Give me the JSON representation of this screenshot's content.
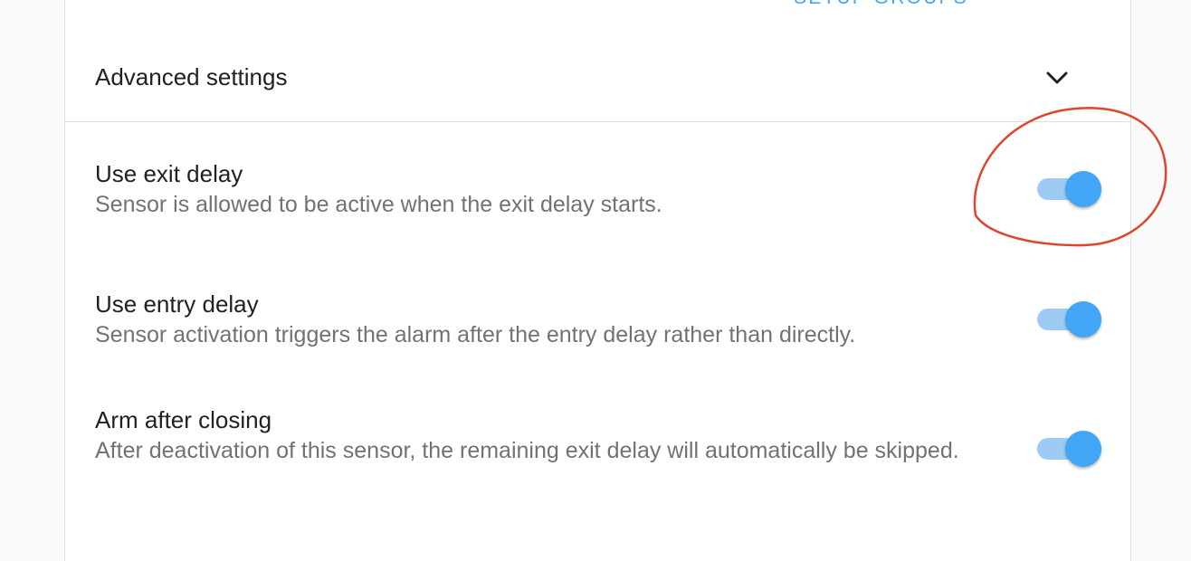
{
  "header": {
    "setup_groups_label": "SETUP GROUPS"
  },
  "advanced": {
    "title": "Advanced settings",
    "expanded": true,
    "chevron_icon": "chevron-down-icon"
  },
  "settings": [
    {
      "title": "Use exit delay",
      "description": "Sensor is allowed to be active when the exit delay starts.",
      "enabled": true
    },
    {
      "title": "Use entry delay",
      "description": "Sensor activation triggers the alarm after the entry delay rather than directly.",
      "enabled": true
    },
    {
      "title": "Arm after closing",
      "description": "After deactivation of this sensor, the remaining exit delay will automatically be skipped.",
      "enabled": true
    }
  ],
  "colors": {
    "accent": "#42a5f5",
    "track": "#9ecbf3",
    "annotation": "#e0452c"
  }
}
